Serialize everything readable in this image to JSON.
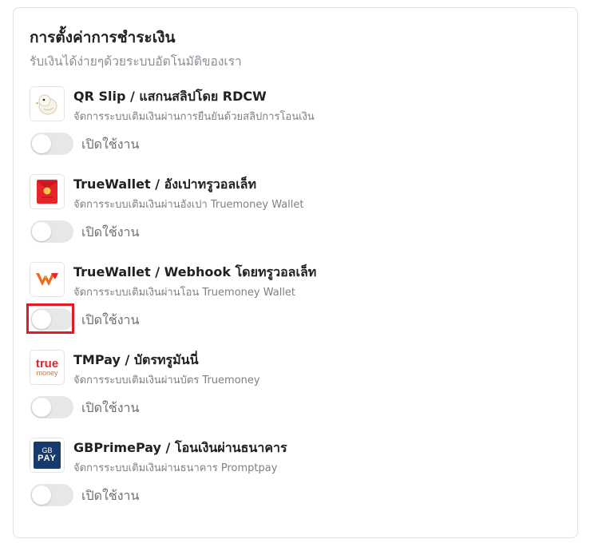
{
  "header": {
    "title": "การตั้งค่าการชำระเงิน",
    "subtitle": "รับเงินได้ง่ายๆด้วยระบบอัตโนมัติของเรา"
  },
  "toggle_label": "เปิดใช้งาน",
  "methods": [
    {
      "name": "QR Slip / แสกนสลิปโดย RDCW",
      "desc": "จัดการระบบเติมเงินผ่านการยืนยันด้วยสลิปการโอนเงิน",
      "icon": "duck-icon",
      "enabled": false
    },
    {
      "name": "TrueWallet / อังเปาทรูวอลเล็ท",
      "desc": "จัดการระบบเติมเงินผ่านอังเปา Truemoney Wallet",
      "icon": "red-envelope-icon",
      "enabled": false
    },
    {
      "name": "TrueWallet / Webhook โดยทรูวอลเล็ท",
      "desc": "จัดการระบบเติมเงินผ่านโอน Truemoney Wallet",
      "icon": "truemoney-wallet-icon",
      "enabled": false
    },
    {
      "name": "TMPay / บัตรทรูมันนี่",
      "desc": "จัดการระบบเติมเงินผ่านบัตร Truemoney",
      "icon": "true-money-logo",
      "enabled": false
    },
    {
      "name": "GBPrimePay / โอนเงินผ่านธนาคาร",
      "desc": "จัดการระบบเติมเงินผ่านธนาคาร Promptpay",
      "icon": "gb-pay-logo",
      "enabled": false
    }
  ],
  "logos": {
    "true_money_top": "true",
    "true_money_bottom": "money",
    "gb_top": "GB",
    "gb_bottom": "PAY"
  },
  "colors": {
    "highlight": "#e01b24",
    "truemoney_orange": "#f26822",
    "red_envelope": "#e8242b",
    "gb_navy": "#163a6b"
  }
}
